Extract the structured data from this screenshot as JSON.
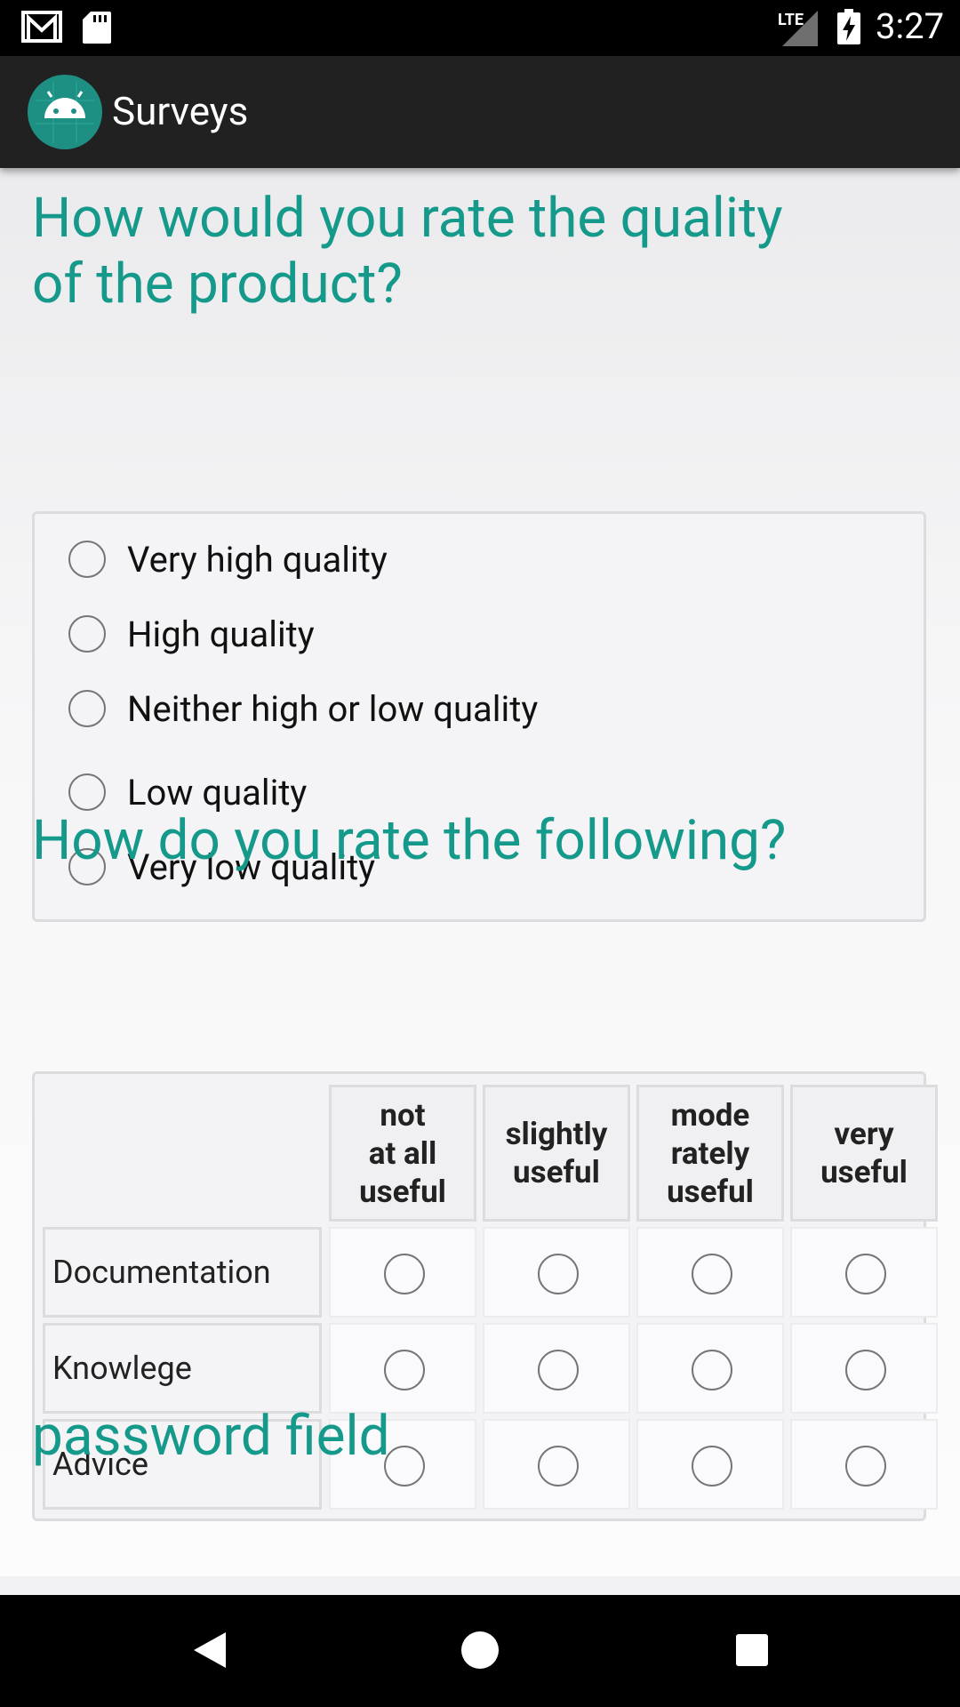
{
  "status_bar": {
    "time": "3:27",
    "network": "LTE",
    "icons": [
      "gmail-icon",
      "sd-card-icon",
      "signal-icon",
      "battery-charging-icon"
    ]
  },
  "app_bar": {
    "title": "Surveys",
    "icon": "android-logo-icon"
  },
  "colors": {
    "accent": "#14998a",
    "app_bar": "#212121",
    "status_bar": "#000000"
  },
  "question1": {
    "title": "How would you rate the quality of the product?",
    "options": [
      "Very high quality",
      "High quality",
      "Neither high or low quality",
      "Low quality",
      "Very low quality"
    ]
  },
  "question2": {
    "title": "How do you rate the following?",
    "columns": [
      "not\nat all\nuseful",
      "slightly\nuseful",
      "mode\nrately\nuseful",
      "very\nuseful"
    ],
    "rows": [
      "Documentation",
      "Knowlege",
      "Advice"
    ]
  },
  "question3": {
    "title": "password field"
  },
  "nav_bar": {
    "icons": [
      "back-icon",
      "home-icon",
      "recents-icon"
    ]
  }
}
